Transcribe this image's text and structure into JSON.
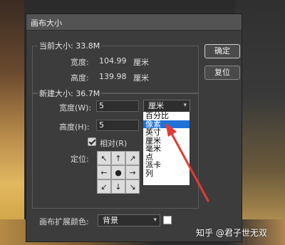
{
  "dialog": {
    "title": "画布大小",
    "current": {
      "heading": "当前大小: 33.8M",
      "width_label": "宽度:",
      "width_value": "104.99",
      "width_unit": "厘米",
      "height_label": "高度:",
      "height_value": "139.98",
      "height_unit": "厘米"
    },
    "new_size": {
      "heading": "新建大小: 36.7M",
      "width_label": "宽度(W):",
      "width_value": "5",
      "height_label": "高度(H):",
      "height_value": "5",
      "unit_selected": "厘米",
      "relative_label": "相对(R)",
      "relative_checked": true,
      "anchor_label": "定位:"
    },
    "buttons": {
      "ok": "确定",
      "reset": "复位"
    },
    "unit_options": [
      "百分比",
      "像素",
      "英寸",
      "厘米",
      "毫米",
      "点",
      "派卡",
      "列"
    ],
    "unit_highlighted": "像素",
    "extension": {
      "label": "画布扩展颜色:",
      "value": "背景",
      "swatch_color": "#ffffff"
    }
  },
  "anchor_glyphs": [
    "↖",
    "↑",
    "↗",
    "←",
    "●",
    "→",
    "↙",
    "↓",
    "↘"
  ],
  "watermark": "知乎 @君子世无双",
  "colors": {
    "highlight": "#1f72d8",
    "annotation_arrow": "#e53935"
  }
}
